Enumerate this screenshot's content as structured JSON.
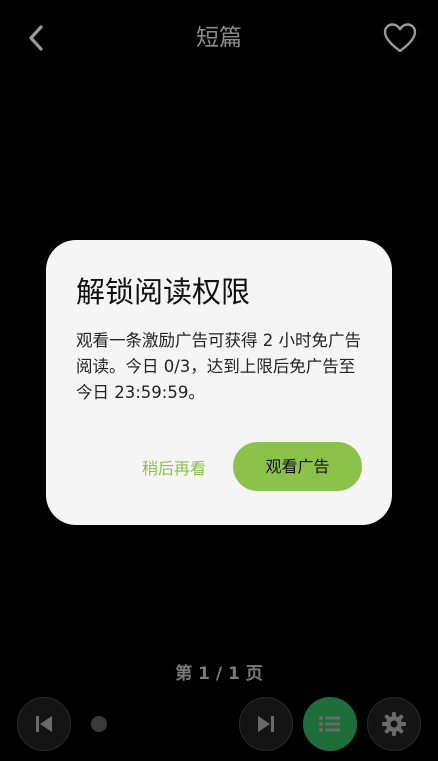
{
  "header": {
    "title": "短篇",
    "back_icon": "chevron-left-icon",
    "favorite_icon": "heart-outline-icon"
  },
  "dialog": {
    "title": "解锁阅读权限",
    "body": "观看一条激励广告可获得 2 小时免广告阅读。今日 0/3，达到上限后免广告至今日 23:59:59。",
    "later_label": "稍后再看",
    "watch_label": "观看广告"
  },
  "footer": {
    "page_indicator": "第 1 / 1 页",
    "progress": 0.0,
    "prev_icon": "skip-previous-icon",
    "next_icon": "skip-next-icon",
    "toc_icon": "list-icon",
    "settings_icon": "gear-icon"
  },
  "colors": {
    "background": "#000000",
    "dialog_bg": "#f5f5f5",
    "accent": "#8bc34a",
    "toc_button": "#1f6e3a",
    "muted_text": "#7a7a7a"
  }
}
